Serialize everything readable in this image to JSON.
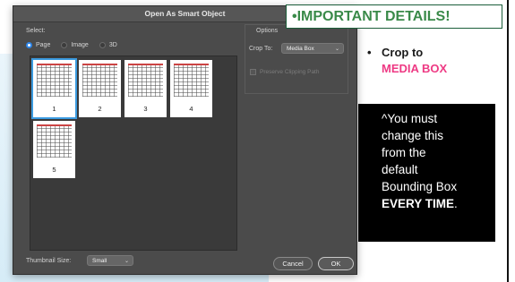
{
  "dialog": {
    "title": "Open As Smart Object",
    "select_label": "Select:",
    "radios": [
      {
        "label": "Page",
        "selected": true
      },
      {
        "label": "Image",
        "selected": false
      },
      {
        "label": "3D",
        "selected": false
      }
    ],
    "thumbnails": [
      {
        "number": "1",
        "selected": true
      },
      {
        "number": "2",
        "selected": false
      },
      {
        "number": "3",
        "selected": false
      },
      {
        "number": "4",
        "selected": false
      },
      {
        "number": "5",
        "selected": false
      }
    ],
    "thumbnail_size_label": "Thumbnail Size:",
    "thumbnail_size_value": "Small",
    "options": {
      "title": "Options",
      "crop_to_label": "Crop To:",
      "crop_to_value": "Media Box",
      "preserve_clipping_label": "Preserve Clipping Path",
      "preserve_clipping_checked": false
    },
    "buttons": {
      "cancel": "Cancel",
      "ok": "OK"
    }
  },
  "callout": {
    "header": "•IMPORTANT DETAILS!",
    "crop_note_line1": "Crop to",
    "crop_note_line2": "MEDIA BOX",
    "black_box": {
      "line1": "^You must",
      "line2": "change this",
      "line3": "from the",
      "line4": "default",
      "line5": "Bounding Box",
      "emphasis": "EVERY TIME",
      "end": "."
    }
  },
  "colors": {
    "header_text": "#3a8a49",
    "media_box_text": "#ee3a84",
    "dialog_bg": "#4b4b4b",
    "selection_blue": "#3b9be0"
  }
}
